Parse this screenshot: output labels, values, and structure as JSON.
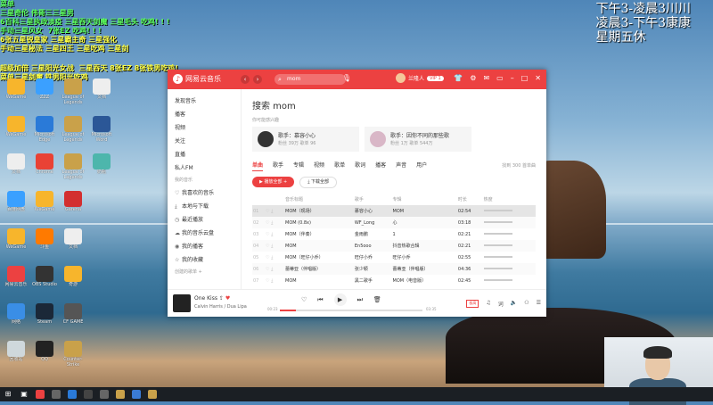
{
  "overlay": {
    "green_lines": "菜单\n三星奇伦 伟哥三三星男\n6百科三星执政淡疫 三星吞天剑魔 三星毛头 吃鸡! ! !\n手动三星风女  7张EZ 吃鸡! ! !",
    "yellow_lines": "6张五星锐皇家 三星霸主奇 三星强化\n手动三星秘法 三星四王 三星吃鸡 三星剑",
    "yellow_lines2": "超级加倍 三星阳光女战  三星吞天 8张EZ 8张铁男吃鸡!\n菜单三星剑魔 铁男阳光吃鸡"
  },
  "clock": {
    "line1": "下午3-凌晨3川川",
    "line2": "凌晨3-下午3康康",
    "line3": "星期五休"
  },
  "desktop": {
    "icons": [
      {
        "label": "WeGame"
      },
      {
        "label": "ZZZ"
      },
      {
        "label": "League of Legends"
      },
      {
        "label": "文档"
      },
      {
        "label": "WeGame"
      },
      {
        "label": "Microsoft Edge"
      },
      {
        "label": "League of Legends"
      },
      {
        "label": "Microsoft Word"
      },
      {
        "label": "文档"
      },
      {
        "label": "Chrome"
      },
      {
        "label": "League of Legends"
      },
      {
        "label": "奶瓶"
      },
      {
        "label": "百度网盘"
      },
      {
        "label": "WeGame"
      },
      {
        "label": "Garena"
      },
      {
        "label": "WeGame"
      },
      {
        "label": "斗鱼"
      },
      {
        "label": "文档"
      },
      {
        "label": "网易云音乐"
      },
      {
        "label": "OBS Studio"
      },
      {
        "label": "奇游"
      },
      {
        "label": "网络"
      },
      {
        "label": "Steam"
      },
      {
        "label": "CF GAME"
      },
      {
        "label": "回收站"
      },
      {
        "label": "QQ"
      },
      {
        "label": "Counter-Strike"
      }
    ]
  },
  "app": {
    "brand": "网易云音乐",
    "search_text": "mom",
    "username": "兰隆人",
    "vip": "VIP 1",
    "sidebar": {
      "items": [
        "发现音乐",
        "播客",
        "视频",
        "关注",
        "直播",
        "私人FM"
      ],
      "section_my": "我的音乐",
      "my_items": [
        "我喜欢的音乐",
        "本地与下载",
        "最近播放",
        "我的音乐云盘",
        "我的播客",
        "我的收藏"
      ],
      "section_created": "创建的歌单"
    },
    "search_title": "搜索 mom",
    "maybe_like": "你可能感兴趣",
    "cards": [
      {
        "title": "歌手：慕容小心",
        "sub": "粉丝 39万  歌单 96"
      },
      {
        "title": "歌手：因你不同的那些歌",
        "sub": "粉丝 1万  歌单 544万"
      }
    ],
    "tabs": [
      "单曲",
      "歌手",
      "专辑",
      "视频",
      "歌单",
      "歌词",
      "播客",
      "声音",
      "用户"
    ],
    "found": "找到 300 首单曲",
    "play_all": "播放全部",
    "download_all": "下载全部",
    "table": {
      "headers": [
        "音乐标题",
        "歌手",
        "专辑",
        "时长",
        "热度"
      ],
      "rows": [
        {
          "idx": "01",
          "title": "MOM（现场）",
          "artist": "慕容小心",
          "album": "MOM",
          "dur": "02:54"
        },
        {
          "idx": "02",
          "title": "MOM (0.8x)",
          "artist": "WF_Long",
          "album": "心",
          "dur": "03:18"
        },
        {
          "idx": "03",
          "title": "MOM（伴奏）",
          "artist": "金雨鹏",
          "album": "1",
          "dur": "02:21"
        },
        {
          "idx": "04",
          "title": "MOM",
          "artist": "En5ooo",
          "album": "抖音热歌合辑",
          "dur": "02:21"
        },
        {
          "idx": "05",
          "title": "MOM（旺仔小乔）",
          "artist": "旺仔小乔",
          "album": "旺仔小乔",
          "dur": "02:55"
        },
        {
          "idx": "06",
          "title": "蕾蒂亚（伴唱版）",
          "artist": "张少颖",
          "album": "蕾蒂亚（伴唱版）",
          "dur": "04:36"
        },
        {
          "idx": "07",
          "title": "MOM",
          "artist": "黑二歌手",
          "album": "MOM（电音版）",
          "dur": "02:45"
        }
      ]
    },
    "player": {
      "title": "One Kiss",
      "artist": "Calvin Harris / Dua Lipa",
      "time_current": "00:23",
      "time_total": "03:35",
      "progress": 0.11,
      "quality": "极高"
    }
  }
}
